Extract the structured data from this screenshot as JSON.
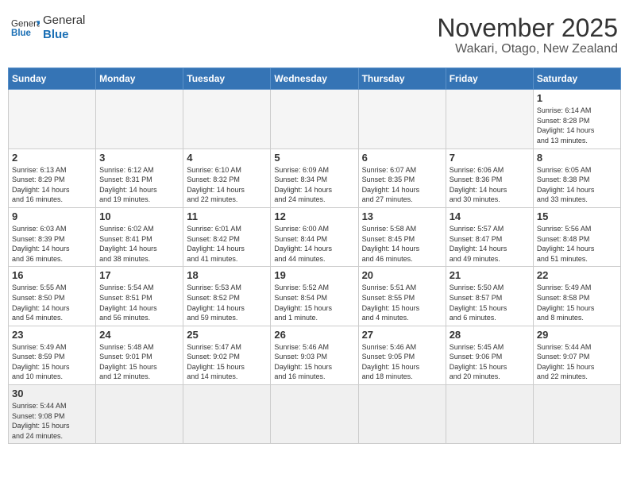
{
  "header": {
    "logo_general": "General",
    "logo_blue": "Blue",
    "month_title": "November 2025",
    "location": "Wakari, Otago, New Zealand"
  },
  "weekdays": [
    "Sunday",
    "Monday",
    "Tuesday",
    "Wednesday",
    "Thursday",
    "Friday",
    "Saturday"
  ],
  "weeks": [
    [
      {
        "day": "",
        "info": ""
      },
      {
        "day": "",
        "info": ""
      },
      {
        "day": "",
        "info": ""
      },
      {
        "day": "",
        "info": ""
      },
      {
        "day": "",
        "info": ""
      },
      {
        "day": "",
        "info": ""
      },
      {
        "day": "1",
        "info": "Sunrise: 6:14 AM\nSunset: 8:28 PM\nDaylight: 14 hours\nand 13 minutes."
      }
    ],
    [
      {
        "day": "2",
        "info": "Sunrise: 6:13 AM\nSunset: 8:29 PM\nDaylight: 14 hours\nand 16 minutes."
      },
      {
        "day": "3",
        "info": "Sunrise: 6:12 AM\nSunset: 8:31 PM\nDaylight: 14 hours\nand 19 minutes."
      },
      {
        "day": "4",
        "info": "Sunrise: 6:10 AM\nSunset: 8:32 PM\nDaylight: 14 hours\nand 22 minutes."
      },
      {
        "day": "5",
        "info": "Sunrise: 6:09 AM\nSunset: 8:34 PM\nDaylight: 14 hours\nand 24 minutes."
      },
      {
        "day": "6",
        "info": "Sunrise: 6:07 AM\nSunset: 8:35 PM\nDaylight: 14 hours\nand 27 minutes."
      },
      {
        "day": "7",
        "info": "Sunrise: 6:06 AM\nSunset: 8:36 PM\nDaylight: 14 hours\nand 30 minutes."
      },
      {
        "day": "8",
        "info": "Sunrise: 6:05 AM\nSunset: 8:38 PM\nDaylight: 14 hours\nand 33 minutes."
      }
    ],
    [
      {
        "day": "9",
        "info": "Sunrise: 6:03 AM\nSunset: 8:39 PM\nDaylight: 14 hours\nand 36 minutes."
      },
      {
        "day": "10",
        "info": "Sunrise: 6:02 AM\nSunset: 8:41 PM\nDaylight: 14 hours\nand 38 minutes."
      },
      {
        "day": "11",
        "info": "Sunrise: 6:01 AM\nSunset: 8:42 PM\nDaylight: 14 hours\nand 41 minutes."
      },
      {
        "day": "12",
        "info": "Sunrise: 6:00 AM\nSunset: 8:44 PM\nDaylight: 14 hours\nand 44 minutes."
      },
      {
        "day": "13",
        "info": "Sunrise: 5:58 AM\nSunset: 8:45 PM\nDaylight: 14 hours\nand 46 minutes."
      },
      {
        "day": "14",
        "info": "Sunrise: 5:57 AM\nSunset: 8:47 PM\nDaylight: 14 hours\nand 49 minutes."
      },
      {
        "day": "15",
        "info": "Sunrise: 5:56 AM\nSunset: 8:48 PM\nDaylight: 14 hours\nand 51 minutes."
      }
    ],
    [
      {
        "day": "16",
        "info": "Sunrise: 5:55 AM\nSunset: 8:50 PM\nDaylight: 14 hours\nand 54 minutes."
      },
      {
        "day": "17",
        "info": "Sunrise: 5:54 AM\nSunset: 8:51 PM\nDaylight: 14 hours\nand 56 minutes."
      },
      {
        "day": "18",
        "info": "Sunrise: 5:53 AM\nSunset: 8:52 PM\nDaylight: 14 hours\nand 59 minutes."
      },
      {
        "day": "19",
        "info": "Sunrise: 5:52 AM\nSunset: 8:54 PM\nDaylight: 15 hours\nand 1 minute."
      },
      {
        "day": "20",
        "info": "Sunrise: 5:51 AM\nSunset: 8:55 PM\nDaylight: 15 hours\nand 4 minutes."
      },
      {
        "day": "21",
        "info": "Sunrise: 5:50 AM\nSunset: 8:57 PM\nDaylight: 15 hours\nand 6 minutes."
      },
      {
        "day": "22",
        "info": "Sunrise: 5:49 AM\nSunset: 8:58 PM\nDaylight: 15 hours\nand 8 minutes."
      }
    ],
    [
      {
        "day": "23",
        "info": "Sunrise: 5:49 AM\nSunset: 8:59 PM\nDaylight: 15 hours\nand 10 minutes."
      },
      {
        "day": "24",
        "info": "Sunrise: 5:48 AM\nSunset: 9:01 PM\nDaylight: 15 hours\nand 12 minutes."
      },
      {
        "day": "25",
        "info": "Sunrise: 5:47 AM\nSunset: 9:02 PM\nDaylight: 15 hours\nand 14 minutes."
      },
      {
        "day": "26",
        "info": "Sunrise: 5:46 AM\nSunset: 9:03 PM\nDaylight: 15 hours\nand 16 minutes."
      },
      {
        "day": "27",
        "info": "Sunrise: 5:46 AM\nSunset: 9:05 PM\nDaylight: 15 hours\nand 18 minutes."
      },
      {
        "day": "28",
        "info": "Sunrise: 5:45 AM\nSunset: 9:06 PM\nDaylight: 15 hours\nand 20 minutes."
      },
      {
        "day": "29",
        "info": "Sunrise: 5:44 AM\nSunset: 9:07 PM\nDaylight: 15 hours\nand 22 minutes."
      }
    ],
    [
      {
        "day": "30",
        "info": "Sunrise: 5:44 AM\nSunset: 9:08 PM\nDaylight: 15 hours\nand 24 minutes."
      },
      {
        "day": "",
        "info": ""
      },
      {
        "day": "",
        "info": ""
      },
      {
        "day": "",
        "info": ""
      },
      {
        "day": "",
        "info": ""
      },
      {
        "day": "",
        "info": ""
      },
      {
        "day": "",
        "info": ""
      }
    ]
  ]
}
